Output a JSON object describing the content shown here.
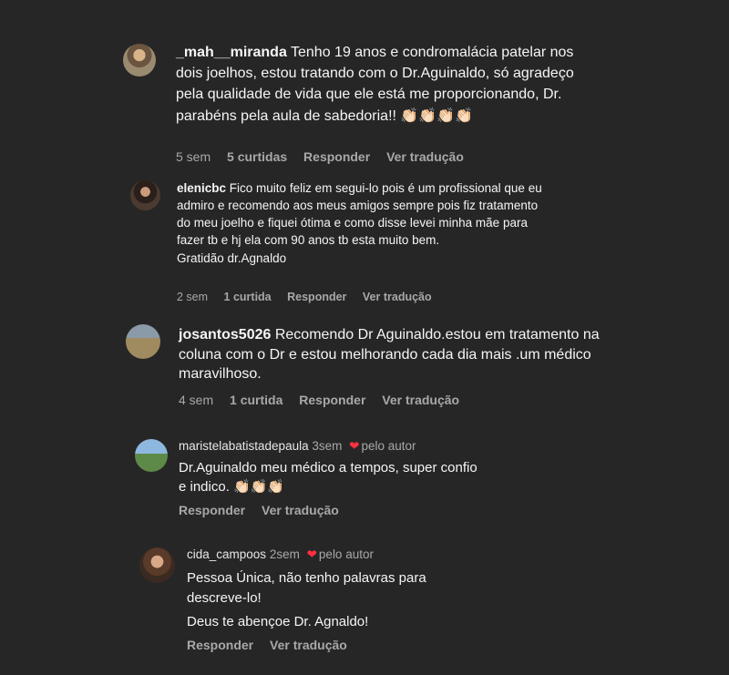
{
  "comments": [
    {
      "username": "_mah__miranda",
      "text": "Tenho 19 anos e condromalácia patelar nos dois joelhos, estou tratando com o Dr.Aguinaldo, só agradeço pela qualidade de vida que ele está me proporcionando, Dr. parabéns pela aula de sabedoria!! 👏🏻👏🏻👏🏻👏🏻",
      "time": "5 sem",
      "likes": "5 curtidas",
      "reply": "Responder",
      "translate": "Ver tradução"
    },
    {
      "username": "elenicbc",
      "text": "Fico muito feliz em segui-lo pois é um profissional que eu admiro e recomendo aos meus amigos sempre pois fiz tratamento do meu joelho e fiquei ótima e como disse levei minha mãe para fazer tb e hj ela com 90 anos tb esta muito bem.",
      "text2": "Gratidão dr.Agnaldo",
      "time": "2 sem",
      "likes": "1 curtida",
      "reply": "Responder",
      "translate": "Ver tradução"
    },
    {
      "username": "josantos5026",
      "text": "Recomendo Dr Aguinaldo.estou em tratamento na coluna com o Dr e estou melhorando cada dia mais .um médico maravilhoso.",
      "time": "4 sem",
      "likes": "1 curtida",
      "reply": "Responder",
      "translate": "Ver tradução"
    },
    {
      "username": "maristelabatistadepaula",
      "time": "3sem",
      "by_author": "pelo autor",
      "text": "Dr.Aguinaldo meu médico a tempos, super confio e indico. 👏🏻👏🏻👏🏻",
      "reply": "Responder",
      "translate": "Ver tradução"
    },
    {
      "username": "cida_campoos",
      "time": "2sem",
      "by_author": "pelo autor",
      "text": "Pessoa Única, não tenho palavras para descreve-lo!",
      "text2": "Deus te abençoe Dr. Agnaldo!",
      "reply": "Responder",
      "translate": "Ver tradução"
    }
  ],
  "icons": {
    "heart": "heart-icon"
  },
  "colors": {
    "background": "#262626",
    "text": "#f5f5f5",
    "muted": "#a8a8a8",
    "heart": "#ff3040"
  }
}
